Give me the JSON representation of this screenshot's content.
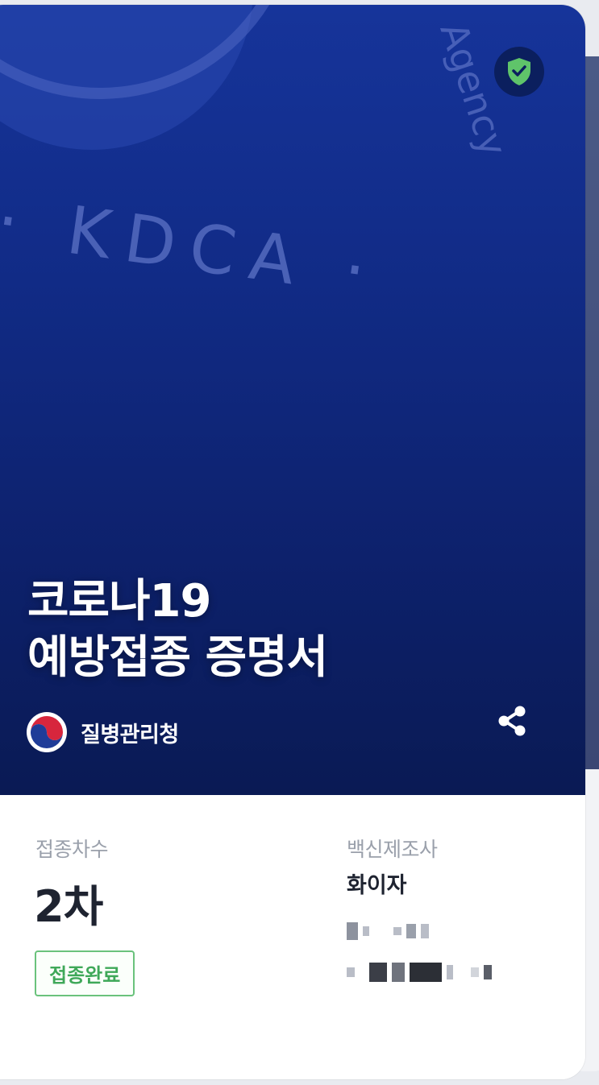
{
  "certificate": {
    "title_line1": "코로나19",
    "title_line2": "예방접종 증명서",
    "agency_name": "질병관리청",
    "watermark_text": "· KDCA ·",
    "watermark_arc_text": "Agency",
    "verified_icon": "shield-check-icon",
    "share_icon": "share-icon"
  },
  "details": {
    "dose_label": "접종차수",
    "dose_value": "2차",
    "status_label": "접종완료",
    "manufacturer_label": "백신제조사",
    "manufacturer_value": "화이자"
  },
  "colors": {
    "hero_top": "#16349a",
    "hero_bottom": "#0a1a54",
    "status_green": "#3fa859",
    "shield_green": "#4caf50"
  }
}
